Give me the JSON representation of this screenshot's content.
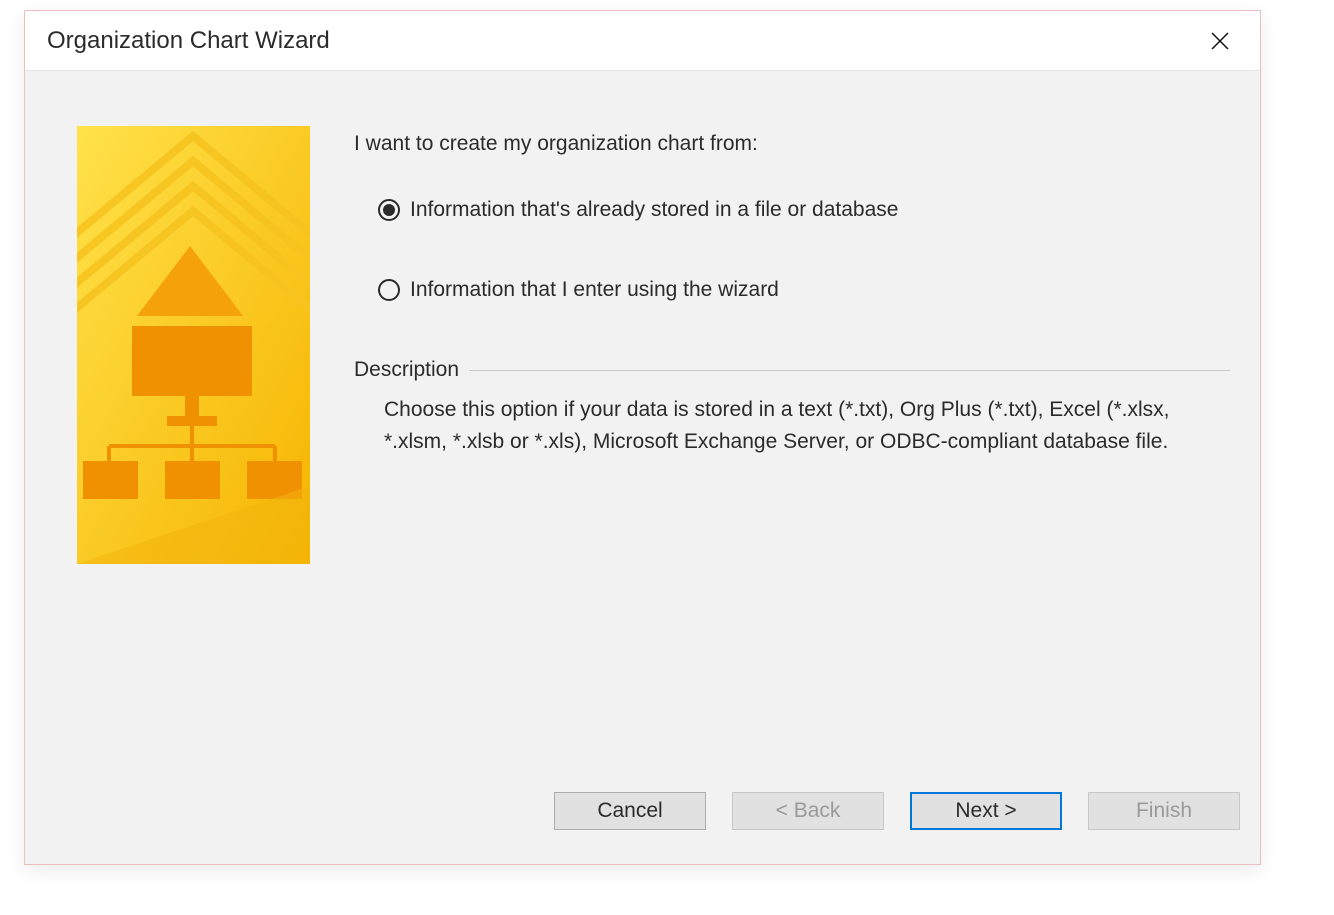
{
  "dialog": {
    "title": "Organization Chart Wizard"
  },
  "content": {
    "prompt": "I want to create my organization chart from:",
    "options": [
      {
        "label": "Information that's already stored in a file or database",
        "selected": true
      },
      {
        "label": "Information that I enter using the wizard",
        "selected": false
      }
    ],
    "description_header": "Description",
    "description_text": "Choose this option if your data is stored in a text (*.txt), Org Plus (*.txt), Excel (*.xlsx, *.xlsm, *.xlsb or *.xls), Microsoft Exchange Server, or ODBC-compliant database file."
  },
  "buttons": {
    "cancel": "Cancel",
    "back": "< Back",
    "next": "Next >",
    "finish": "Finish"
  }
}
